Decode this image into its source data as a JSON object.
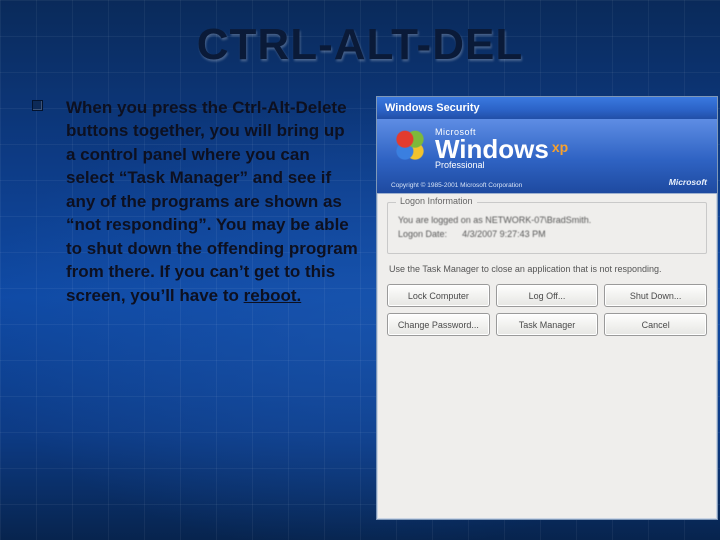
{
  "title": "CTRL-ALT-DEL",
  "body_text_before": "When you press the Ctrl-Alt-Delete buttons together, you will bring up a control panel where you can select “Task Manager” and see if any of the programs are shown as “not responding”.  You may be able to shut down the offending program from there.  If you can’t get to this screen, you’ll have to ",
  "body_text_underlined": "reboot.",
  "dialog": {
    "title": "Windows Security",
    "wordmark_ms": "Microsoft",
    "wordmark_win": "Windows",
    "wordmark_xp": "xp",
    "wordmark_pro": "Professional",
    "copyright": "Copyright © 1985-2001  Microsoft Corporation",
    "ms_right": "Microsoft",
    "group_legend": "Logon Information",
    "logon_line": "You are logged on as ",
    "logon_value": "NETWORK-07\\BradSmith.",
    "logon_date_label": "Logon Date:",
    "logon_date_value": "4/3/2007 9:27:43 PM",
    "note": "Use the Task Manager to close an application that is not responding.",
    "buttons": {
      "lock": "Lock Computer",
      "logoff": "Log Off...",
      "shutdown": "Shut Down...",
      "changepw": "Change Password...",
      "taskmgr": "Task Manager",
      "cancel": "Cancel"
    }
  }
}
